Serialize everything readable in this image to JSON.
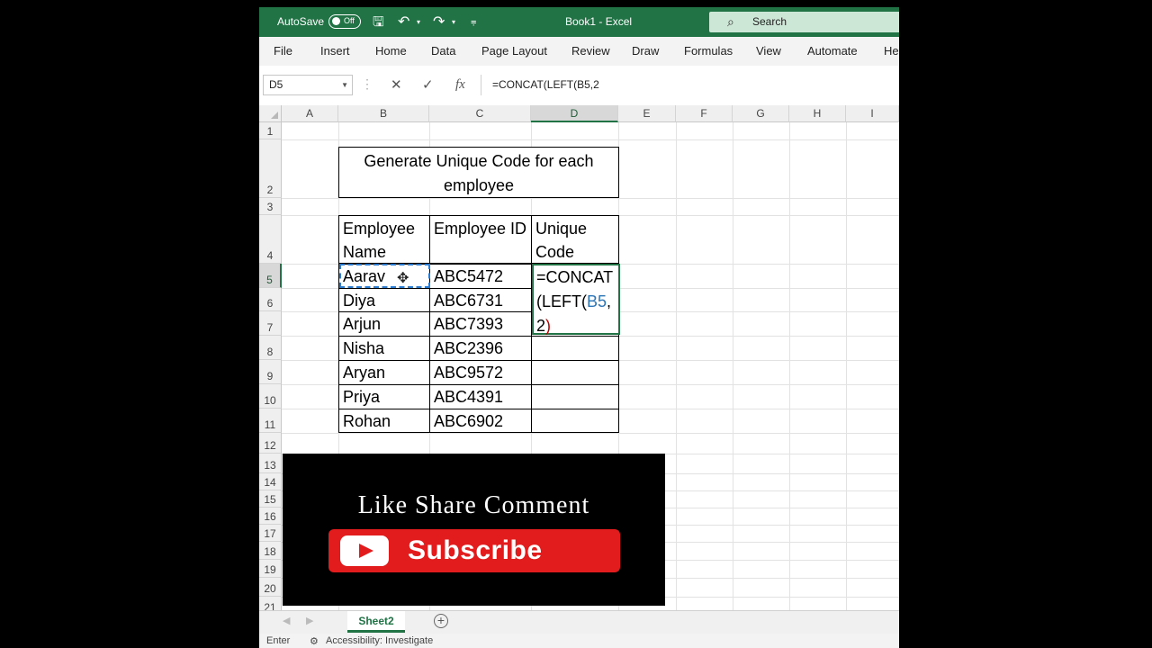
{
  "titlebar": {
    "autosave_label": "AutoSave",
    "autosave_state": "Off",
    "title": "Book1  -  Excel",
    "search_label": "Search"
  },
  "menu": [
    "File",
    "Insert",
    "Home",
    "Data",
    "Page Layout",
    "Review",
    "Draw",
    "Formulas",
    "View",
    "Automate",
    "Hel"
  ],
  "formula_bar": {
    "name_box": "D5",
    "formula": "=CONCAT(LEFT(B5,2"
  },
  "columns": [
    "A",
    "B",
    "C",
    "D",
    "E",
    "F",
    "G",
    "H",
    "I"
  ],
  "selected_column": "D",
  "rows": [
    "1",
    "2",
    "3",
    "4",
    "5",
    "6",
    "7",
    "8",
    "9",
    "10",
    "11",
    "12",
    "13",
    "14",
    "15",
    "16",
    "17",
    "18",
    "19",
    "20",
    "21"
  ],
  "selected_row": "5",
  "sheet": {
    "title": "Generate Unique Code for each employee",
    "headers": [
      "Employee Name",
      "Employee ID",
      "Unique Code"
    ],
    "employees": [
      {
        "name": "Aarav",
        "id": "ABC5472"
      },
      {
        "name": "Diya",
        "id": "ABC6731"
      },
      {
        "name": "Arjun",
        "id": "ABC7393"
      },
      {
        "name": "Nisha",
        "id": "ABC2396"
      },
      {
        "name": "Aryan",
        "id": "ABC9572"
      },
      {
        "name": "Priya",
        "id": "ABC4391"
      },
      {
        "name": "Rohan",
        "id": "ABC6902"
      }
    ],
    "editing_cell": {
      "prefix": "=CONCAT(LEFT(",
      "ref": "B5",
      "suffix": ",2",
      "close": ")"
    }
  },
  "promo": {
    "text": "Like Share Comment",
    "button": "Subscribe"
  },
  "tabs": {
    "active": "Sheet2"
  },
  "status": {
    "mode": "Enter",
    "accessibility": "Accessibility: Investigate"
  },
  "colors": {
    "excel_green": "#217346",
    "ref_blue": "#2e75b6",
    "subscribe_red": "#e21c1c"
  }
}
